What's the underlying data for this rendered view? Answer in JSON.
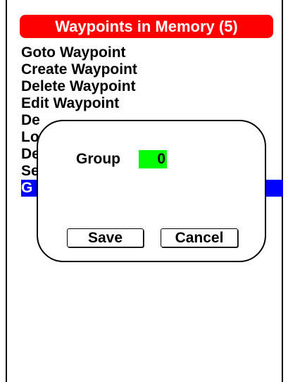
{
  "header": {
    "title": "Waypoints in Memory (5)"
  },
  "menu": {
    "items": [
      {
        "label": "Goto Waypoint"
      },
      {
        "label": "Create Waypoint"
      },
      {
        "label": "Delete Waypoint"
      },
      {
        "label": "Edit Waypoint"
      },
      {
        "label": "De"
      },
      {
        "label": "Lo"
      },
      {
        "label": "De"
      },
      {
        "label": "Se"
      },
      {
        "label": "G"
      }
    ],
    "selected_index": 8
  },
  "dialog": {
    "field_label": "Group",
    "field_value": "0",
    "save_label": "Save",
    "cancel_label": "Cancel"
  },
  "colors": {
    "title_bg": "#ff0000",
    "selection_bg": "#0000ff",
    "value_bg": "#00ff00"
  }
}
